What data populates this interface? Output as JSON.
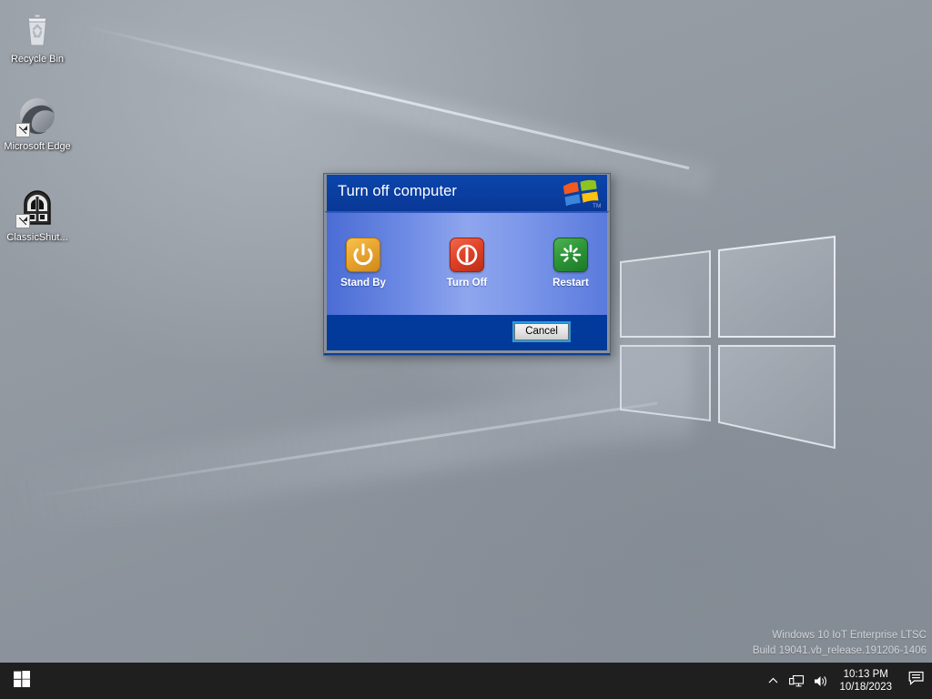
{
  "desktop": {
    "icons": [
      {
        "name": "recycle-bin",
        "label": "Recycle Bin",
        "shortcut": false
      },
      {
        "name": "microsoft-edge",
        "label": "Microsoft Edge",
        "shortcut": true
      },
      {
        "name": "classic-shutdown",
        "label": "ClassicShut...",
        "shortcut": true
      }
    ],
    "wallpaper": {
      "description": "Windows 10 hero logo, grayscale",
      "base_color": "#8f969f",
      "logo_color": "#c8ced6"
    }
  },
  "dialog": {
    "title": "Turn off computer",
    "logo_name": "windows-xp-flag-logo",
    "trademark": "TM",
    "title_bar_color": "#0a3ea0",
    "body_gradient": [
      "#4a6cd4",
      "#8fa6ee",
      "#5a7add"
    ],
    "footer_color": "#023a9c",
    "actions": [
      {
        "name": "stand-by",
        "label": "Stand By",
        "icon": "power-standby-icon",
        "color": "#e9a52f"
      },
      {
        "name": "turn-off",
        "label": "Turn Off",
        "icon": "power-off-icon",
        "color": "#e04328"
      },
      {
        "name": "restart",
        "label": "Restart",
        "icon": "restart-burst-icon",
        "color": "#2e9638"
      }
    ],
    "cancel_label": "Cancel"
  },
  "watermark": {
    "line1": "Windows 10 IoT Enterprise LTSC",
    "line2": "Build 19041.vb_release.191206-1406"
  },
  "taskbar": {
    "start_label": "Start",
    "tray": {
      "overflow_icon": "chevron-up-icon",
      "network_icon": "network-monitor-icon",
      "volume_icon": "speaker-volume-icon",
      "action_center_icon": "action-center-icon",
      "time": "10:13 PM",
      "date": "10/18/2023"
    }
  }
}
